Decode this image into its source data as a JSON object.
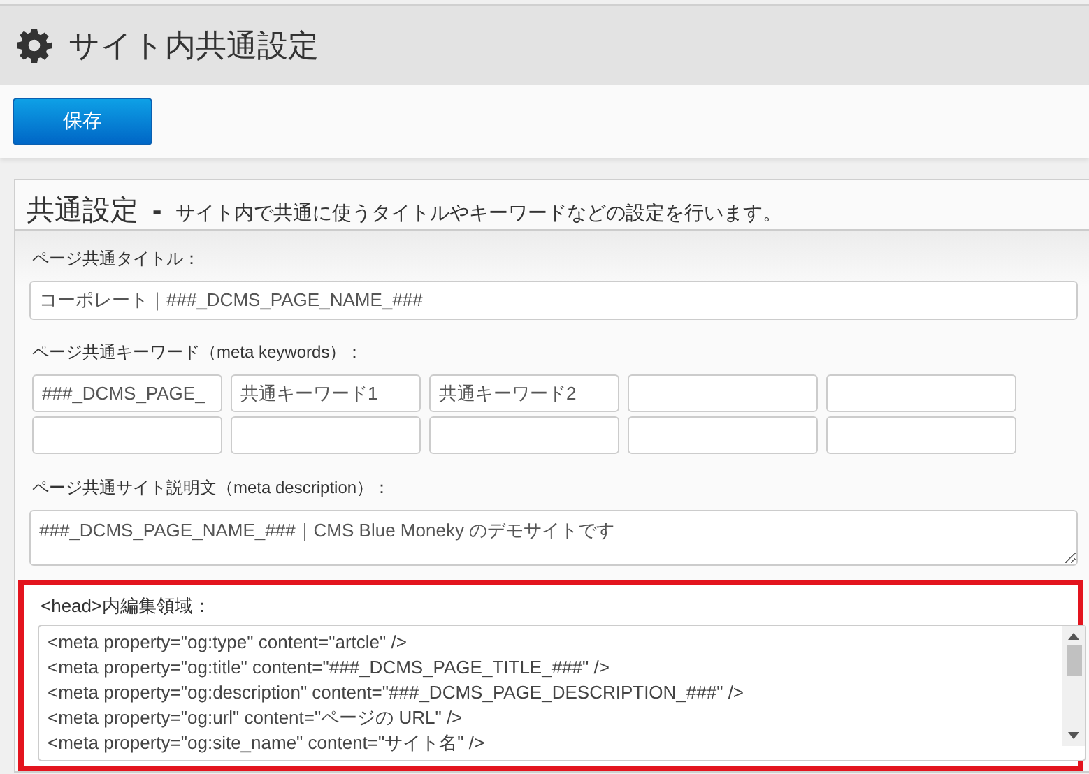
{
  "page_title": "サイト内共通設定",
  "save_button": "保存",
  "panel": {
    "title": "共通設定",
    "separator": "-",
    "description": "サイト内で共通に使うタイトルやキーワードなどの設定を行います。",
    "fields": [
      {
        "kind": "text",
        "label": "ページ共通タイトル：",
        "value": "コーポレート｜###_DCMS_PAGE_NAME_###"
      },
      {
        "kind": "keywords",
        "label": "ページ共通キーワード（meta keywords）：",
        "keywords": [
          {
            "kind": "text",
            "value": "###_DCMS_PAGE_"
          },
          {
            "kind": "text",
            "value": "共通キーワード1"
          },
          {
            "kind": "text",
            "value": "共通キーワード2"
          },
          {
            "kind": "empty"
          },
          {
            "kind": "empty"
          },
          {
            "kind": "empty"
          },
          {
            "kind": "empty"
          },
          {
            "kind": "empty"
          },
          {
            "kind": "empty"
          },
          {
            "kind": "empty"
          }
        ]
      },
      {
        "kind": "textarea",
        "label": "ページ共通サイト説明文（meta description）：",
        "value": "###_DCMS_PAGE_NAME_###｜CMS Blue Moneky のデモサイトです"
      },
      {
        "kind": "code",
        "highlighted": true,
        "label": "<head>内編集領域：",
        "lines": [
          "<meta property=\"og:type\" content=\"artcle\" />",
          "<meta property=\"og:title\" content=\"###_DCMS_PAGE_TITLE_###\" />",
          "<meta property=\"og:description\" content=\"###_DCMS_PAGE_DESCRIPTION_###\" />",
          "<meta property=\"og:url\" content=\"ページの URL\" />",
          "<meta property=\"og:site_name\" content=\"サイト名\" />"
        ]
      }
    ]
  }
}
